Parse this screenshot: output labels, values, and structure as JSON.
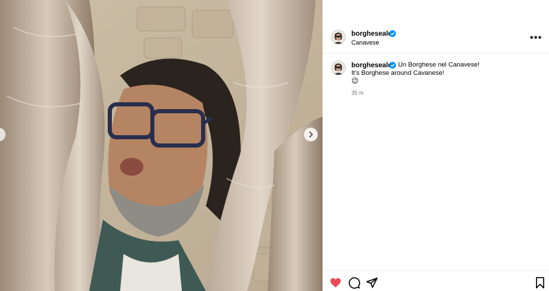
{
  "post": {
    "username": "borgheseale",
    "location": "Canavese",
    "caption": {
      "username": "borgheseale",
      "line1": "Un Borghese nel Canavese!",
      "line2": "It's Borghese around Cavanese!",
      "emoji": "😉",
      "time": "35 m"
    },
    "more_label": "•••"
  },
  "icons": {
    "verified": "verified-badge-icon",
    "like": "heart-filled-icon",
    "comment": "comment-icon",
    "share": "paper-plane-icon",
    "save": "bookmark-icon",
    "more": "more-options-icon",
    "next": "chevron-right-icon",
    "prev": "chevron-left-icon"
  },
  "colors": {
    "verified": "#0095f6",
    "like": "#ed4956",
    "muted": "#737373",
    "divider": "#efefef"
  }
}
